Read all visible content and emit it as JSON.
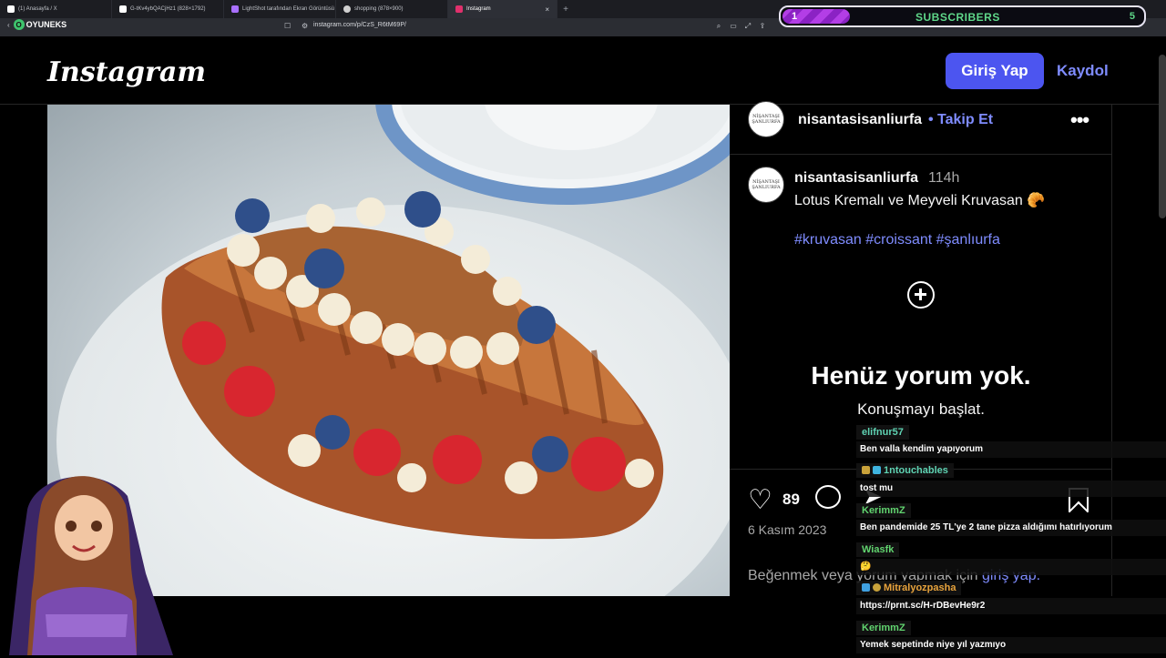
{
  "browser": {
    "tabs": [
      {
        "label": "(1) Anasayfa / X",
        "color": "#ffffff",
        "width": 123
      },
      {
        "label": "G-tKv4ybQACjHz1 (828×1792)",
        "color": "#ffffff",
        "width": 123
      },
      {
        "label": "LightShot tarafından Ekran Görüntüsü",
        "color": "#a970ff",
        "width": 123
      },
      {
        "label": "shopping (878×900)",
        "color": "#d0d0d0",
        "width": 123
      },
      {
        "label": "Instagram",
        "color": "#e1306c",
        "width": 120,
        "active": true
      }
    ],
    "url": "instagram.com/p/CzS_R6tM69P/",
    "brand": "OYUNEKS"
  },
  "subscribers": {
    "current": "1",
    "label": "SUBSCRIBERS",
    "goal": "5",
    "progress": 0.18
  },
  "header": {
    "logo": "Instagram",
    "login": "Giriş Yap",
    "signup": "Kaydol"
  },
  "post": {
    "username": "nisantasisanliurfa",
    "follow": "• Takip Et",
    "avatar_text": "NİŞANTAŞI",
    "avatar_sub": "ŞANLIURFA",
    "time": "114h",
    "caption": "Lotus Kremalı ve Meyveli Kruvasan 🥐",
    "hashtags": "#kruvasan #croissant #şanlıurfa",
    "empty_title": "Henüz yorum yok.",
    "empty_sub": "Konuşmayı başlat.",
    "likes": "89",
    "date": "6 Kasım 2023",
    "login_prompt": "Beğenmek veya yorum yapmak için",
    "login_link": "giriş yap."
  },
  "chat": [
    {
      "name": "elifnur57",
      "color": "teal",
      "text": "Ben valla kendim yapıyorum"
    },
    {
      "name": "1ntouchables",
      "color": "teal",
      "text": "tost mu"
    },
    {
      "name": "KerimmZ",
      "color": "green",
      "text": "Ben pandemide 25 TL'ye 2 tane pizza aldığımı hatırlıyorum"
    },
    {
      "name": "Wiasfk",
      "color": "green",
      "text": "🤔"
    },
    {
      "name": "Mitralyozpasha",
      "color": "orange",
      "text": "https://prnt.sc/H-rDBevHe9r2"
    },
    {
      "name": "KerimmZ",
      "color": "green",
      "text": "Yemek sepetinde niye yıl yazmıyo"
    }
  ]
}
